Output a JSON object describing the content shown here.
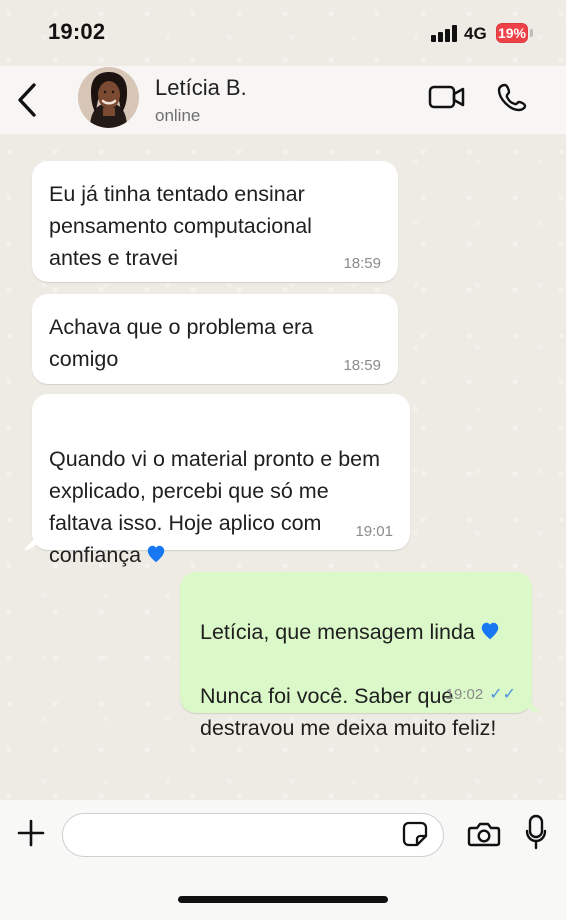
{
  "status_bar": {
    "time": "19:02",
    "network": "4G",
    "battery": "19%"
  },
  "header": {
    "contact_name": "Letícia B.",
    "status": "online"
  },
  "messages": [
    {
      "direction": "incoming",
      "text": "Eu já tinha tentado ensinar\npensamento computacional\nantes e travei",
      "time": "18:59"
    },
    {
      "direction": "incoming",
      "text": "Achava que o problema era\ncomigo",
      "time": "18:59"
    },
    {
      "direction": "incoming",
      "text": "Quando vi o material pronto e bem\nexplicado, percebi que só me\nfaltava isso. Hoje aplico com\nconfiança",
      "time": "19:01"
    },
    {
      "direction": "outgoing",
      "text": "Letícia, que mensagem linda",
      "text_line2": "Nunca foi você. Saber que\ndestravou me deixa muito feliz!",
      "time": "19:02"
    }
  ],
  "composer": {
    "placeholder": ""
  },
  "icons": {
    "back": "chevron-left-icon",
    "video": "video-camera-icon",
    "phone": "phone-icon",
    "plus": "plus-icon",
    "sticker": "sticker-icon",
    "camera": "camera-icon",
    "mic": "microphone-icon",
    "heart": "blue-heart-icon",
    "ticks": "double-check-icon"
  },
  "colors": {
    "incoming_bubble": "#ffffff",
    "outgoing_bubble": "#dbf8c8",
    "background": "#eeebe4",
    "battery": "#ef4148",
    "read_ticks": "#4a93df",
    "heart": "#1877f2"
  }
}
